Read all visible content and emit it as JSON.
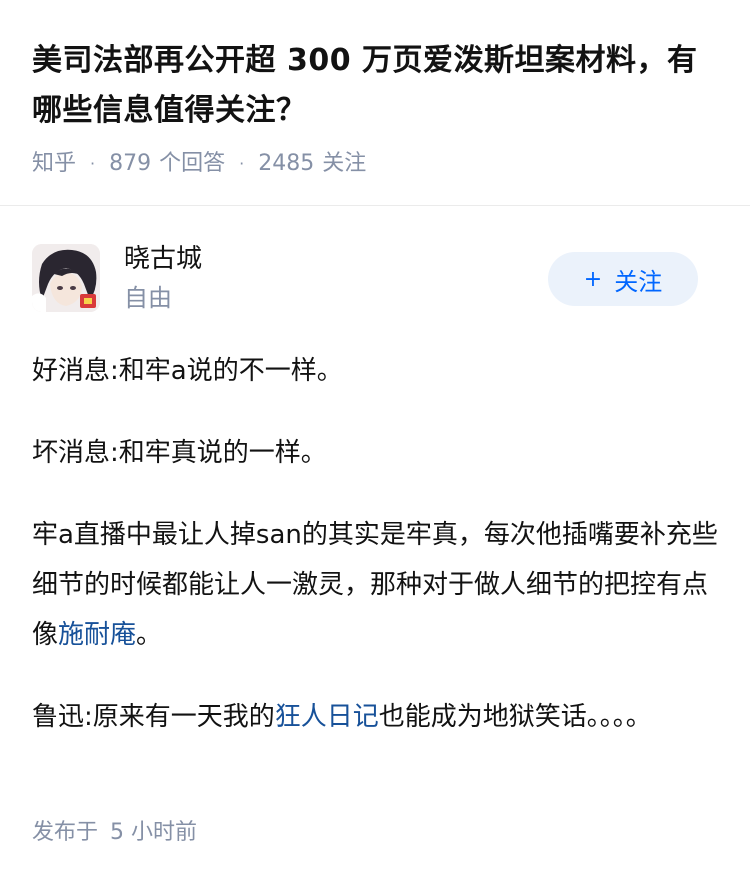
{
  "question": {
    "title": "美司法部再公开超 300 万页爱泼斯坦案材料，有哪些信息值得关注？",
    "source": "知乎",
    "answer_count": "879",
    "answer_label": "个回答",
    "follower_count": "2485",
    "follower_label": "关注"
  },
  "author": {
    "name": "晓古城",
    "headline": "自由",
    "follow_label": "关注",
    "follow_icon": "plus-icon"
  },
  "answer": {
    "p1": "好消息:和牢a说的不一样。",
    "p2": "坏消息:和牢真说的一样。",
    "p3_text": "牢a直播中最让人掉san的其实是牢真，每次他插嘴要补充些细节的时候都能让人一激灵，那种对于做人细节的把控有点像",
    "p3_link": "施耐庵",
    "p3_end": "。",
    "p4_text": "鲁迅:原来有一天我的",
    "p4_link": "狂人日记",
    "p4_end": "也能成为地狱笑话。。。。"
  },
  "footer": {
    "published_label": "发布于",
    "published_time": "5 小时前"
  },
  "colors": {
    "meta_gray": "#8590a6",
    "link_blue": "#175199",
    "accent_blue": "#0066ff",
    "follow_bg": "#ebf2fb"
  }
}
